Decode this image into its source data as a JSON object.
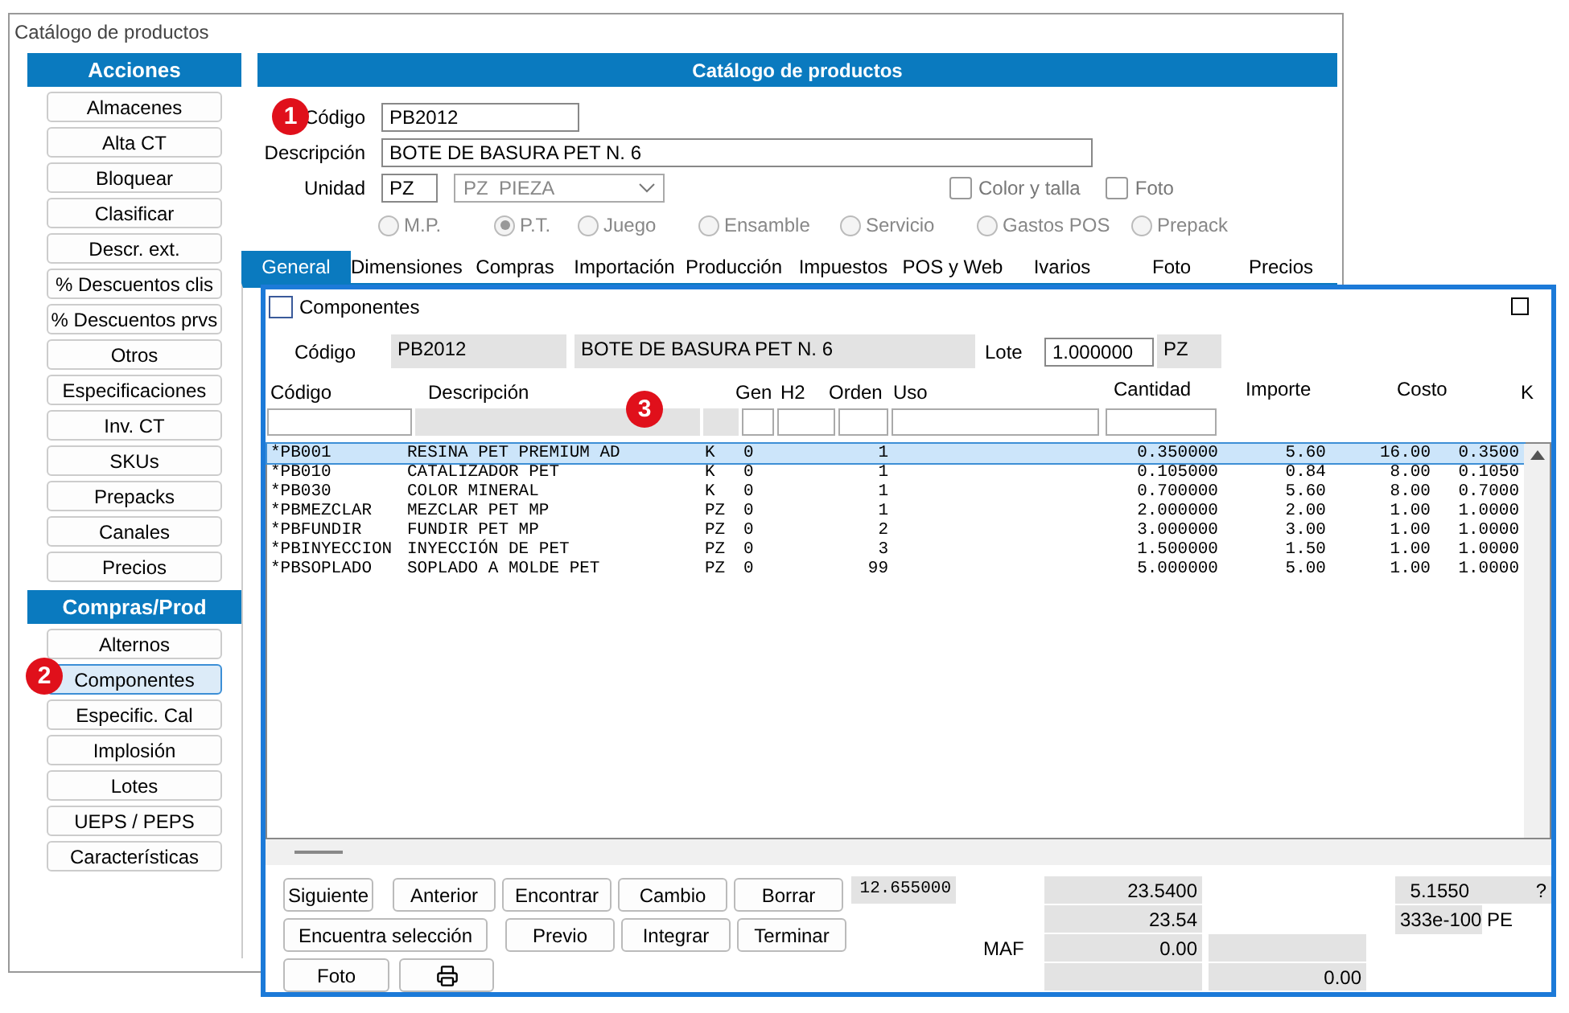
{
  "window": {
    "title": "Catálogo de productos"
  },
  "sidebar": [
    {
      "title": "Acciones",
      "items": [
        {
          "label": "Almacenes",
          "selected": false
        },
        {
          "label": "Alta CT",
          "selected": false
        },
        {
          "label": "Bloquear",
          "selected": false
        },
        {
          "label": "Clasificar",
          "selected": false
        },
        {
          "label": "Descr. ext.",
          "selected": false
        },
        {
          "label": "%  Descuentos clis",
          "selected": false
        },
        {
          "label": "% Descuentos prvs",
          "selected": false
        },
        {
          "label": "Otros",
          "selected": false
        },
        {
          "label": "Especificaciones",
          "selected": false
        },
        {
          "label": "Inv. CT",
          "selected": false
        },
        {
          "label": "SKUs",
          "selected": false
        },
        {
          "label": "Prepacks",
          "selected": false
        },
        {
          "label": "Canales",
          "selected": false
        },
        {
          "label": "Precios",
          "selected": false
        }
      ]
    },
    {
      "title": "Compras/Prod",
      "items": [
        {
          "label": "Alternos",
          "selected": false
        },
        {
          "label": "Componentes",
          "selected": true
        },
        {
          "label": "Especific. Cal",
          "selected": false
        },
        {
          "label": "Implosión",
          "selected": false
        },
        {
          "label": "Lotes",
          "selected": false
        },
        {
          "label": "UEPS / PEPS",
          "selected": false
        },
        {
          "label": "Características",
          "selected": false
        }
      ]
    }
  ],
  "header": "Catálogo de productos",
  "form": {
    "codigo_label": "Código",
    "codigo": "PB2012",
    "descripcion_label": "Descripción",
    "descripcion": "BOTE DE BASURA PET N. 6",
    "unidad_label": "Unidad",
    "unidad": "PZ",
    "unidad_select": "PZ  PIEZA",
    "checkboxes": [
      {
        "label": "Color y talla",
        "checked": false
      },
      {
        "label": "Foto",
        "checked": false
      }
    ],
    "types_disabled": true,
    "types": [
      {
        "label": "M.P.",
        "selected": false
      },
      {
        "label": "P.T.",
        "selected": true
      },
      {
        "label": "Juego",
        "selected": false
      },
      {
        "label": "Ensamble",
        "selected": false
      },
      {
        "label": "Servicio",
        "selected": false
      },
      {
        "label": "Gastos POS",
        "selected": false
      },
      {
        "label": "Prepack",
        "selected": false
      }
    ]
  },
  "tabs": [
    {
      "label": "General",
      "selected": true
    },
    {
      "label": "Dimensiones",
      "selected": false
    },
    {
      "label": "Compras",
      "selected": false
    },
    {
      "label": "Importación",
      "selected": false
    },
    {
      "label": "Producción",
      "selected": false
    },
    {
      "label": "Impuestos",
      "selected": false
    },
    {
      "label": "POS y Web",
      "selected": false
    },
    {
      "label": "Ivarios",
      "selected": false
    },
    {
      "label": "Foto",
      "selected": false
    },
    {
      "label": "Precios",
      "selected": false
    }
  ],
  "markers": [
    "1",
    "2",
    "3"
  ],
  "components": {
    "title": "Componentes",
    "codigo_label": "Código",
    "codigo": "PB2012",
    "descripcion": "BOTE DE BASURA PET N. 6",
    "lote_label": "Lote",
    "lote": "1.000000",
    "lote_unit": "PZ",
    "columns": [
      "Código",
      "Descripción",
      "Gen",
      "H2",
      "Orden",
      "Uso",
      "Cantidad",
      "Importe",
      "Costo",
      "K"
    ],
    "rows": [
      {
        "codigo": "*PB001",
        "descripcion": "RESINA PET PREMIUM AD",
        "unidad": "K",
        "gen": "0",
        "orden": "1",
        "cantidad": "0.350000",
        "importe": "5.60",
        "costo": "16.00",
        "k": "0.3500",
        "selected": true
      },
      {
        "codigo": "*PB010",
        "descripcion": "CATALIZADOR PET",
        "unidad": "K",
        "gen": "0",
        "orden": "1",
        "cantidad": "0.105000",
        "importe": "0.84",
        "costo": "8.00",
        "k": "0.1050",
        "selected": false
      },
      {
        "codigo": "*PB030",
        "descripcion": "COLOR MINERAL",
        "unidad": "K",
        "gen": "0",
        "orden": "1",
        "cantidad": "0.700000",
        "importe": "5.60",
        "costo": "8.00",
        "k": "0.7000",
        "selected": false
      },
      {
        "codigo": "*PBMEZCLAR",
        "descripcion": "MEZCLAR PET MP",
        "unidad": "PZ",
        "gen": "0",
        "orden": "1",
        "cantidad": "2.000000",
        "importe": "2.00",
        "costo": "1.00",
        "k": "1.0000",
        "selected": false
      },
      {
        "codigo": "*PBFUNDIR",
        "descripcion": "FUNDIR PET MP",
        "unidad": "PZ",
        "gen": "0",
        "orden": "2",
        "cantidad": "3.000000",
        "importe": "3.00",
        "costo": "1.00",
        "k": "1.0000",
        "selected": false
      },
      {
        "codigo": "*PBINYECCION",
        "descripcion": "INYECCIÓN DE PET",
        "unidad": "PZ",
        "gen": "0",
        "orden": "3",
        "cantidad": "1.500000",
        "importe": "1.50",
        "costo": "1.00",
        "k": "1.0000",
        "selected": false
      },
      {
        "codigo": "*PBSOPLADO",
        "descripcion": "SOPLADO A MOLDE PET",
        "unidad": "PZ",
        "gen": "0",
        "orden": "99",
        "cantidad": "5.000000",
        "importe": "5.00",
        "costo": "1.00",
        "k": "1.0000",
        "selected": false
      }
    ],
    "button_rows": [
      [
        "Siguiente",
        "Anterior",
        "Encontrar",
        "Cambio",
        "Borrar"
      ],
      [
        "Encuentra selección",
        "Previo",
        "Integrar",
        "Terminar"
      ],
      [
        "Foto"
      ]
    ],
    "totals": {
      "cantidad": "12.655000",
      "importe": "23.5400",
      "importe_redondeo": "23.54",
      "maf_label": "MAF",
      "maf": "0.00",
      "column_b": "0.00",
      "costo": "5.1550",
      "column_d": "?",
      "factor": "333e-100",
      "factor_unit": "PE"
    }
  }
}
